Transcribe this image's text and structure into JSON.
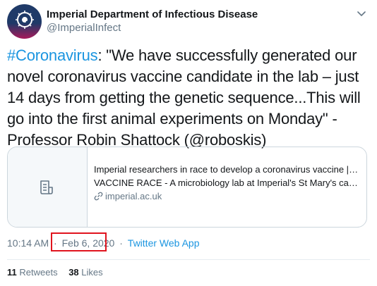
{
  "author": {
    "name": "Imperial Department of Infectious Disease",
    "handle": "@ImperialInfect"
  },
  "tweet": {
    "hashtag": "#Coronavirus",
    "text": ": \"We have successfully generated our novel coronavirus vaccine candidate in the lab – just 14 days from getting the genetic sequence...This will go into the first animal experiments on Monday\" - Professor Robin Shattock (@roboskis)"
  },
  "card": {
    "title": "Imperial researchers in race to develop a coronavirus vaccine | ...",
    "description": "VACCINE RACE - A microbiology lab at Imperial's St Mary's campus is at the centre of a scientific race to develop a vaccin...",
    "domain": "imperial.ac.uk",
    "thumb_icon": "document-icon"
  },
  "meta": {
    "time": "10:14 AM",
    "separator": "·",
    "date": "Feb 6, 2020",
    "source": "Twitter Web App"
  },
  "stats": {
    "retweets_count": "11",
    "retweets_label": "Retweets",
    "likes_count": "38",
    "likes_label": "Likes"
  },
  "colors": {
    "link": "#1b95e0",
    "muted": "#657786",
    "highlight_box": "#e0141e"
  }
}
